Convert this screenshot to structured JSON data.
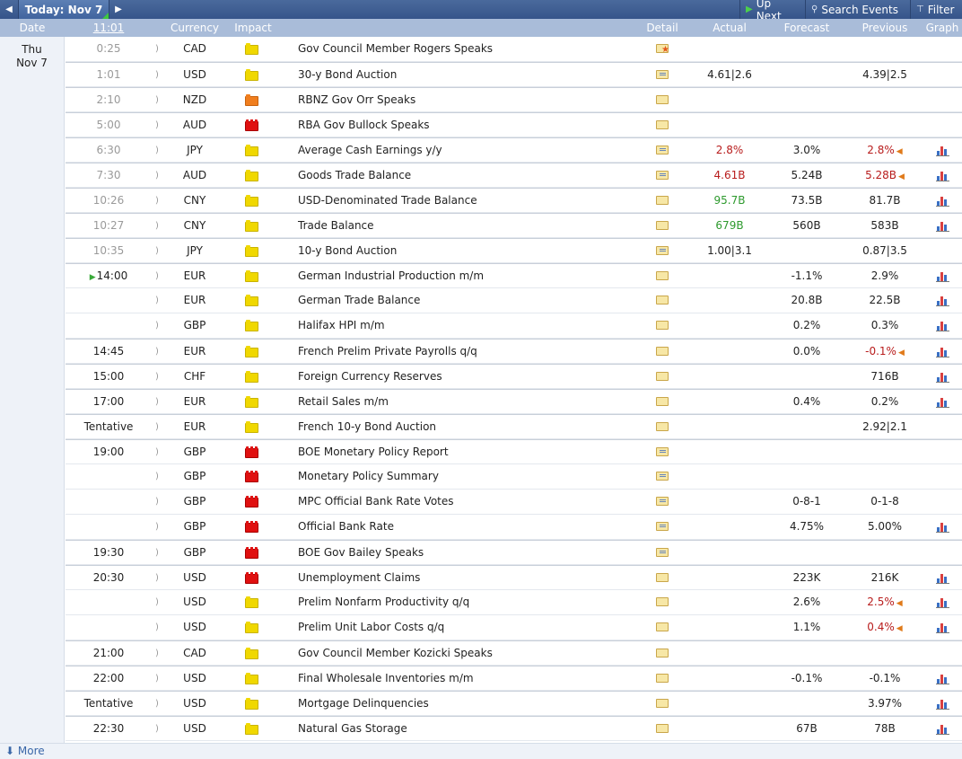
{
  "toolbar": {
    "prev_label": "◀",
    "today_label": "Today: Nov 7",
    "next_label": "▶",
    "up_next_label": "Up Next",
    "search_label": "Search Events",
    "filter_label": "Filter"
  },
  "columns": {
    "date": "Date",
    "clock": "11:01",
    "currency": "Currency",
    "impact": "Impact",
    "detail": "Detail",
    "actual": "Actual",
    "forecast": "Forecast",
    "previous": "Previous",
    "graph": "Graph"
  },
  "date": {
    "weekday": "Thu",
    "day": "Nov 7"
  },
  "events": [
    {
      "time": "0:25",
      "past": true,
      "currency": "CAD",
      "impact": "low",
      "event": "Gov Council Member Rogers Speaks",
      "detail": "star",
      "actual": "",
      "actual_color": "black",
      "forecast": "",
      "previous": "",
      "previous_color": "black",
      "revised": false,
      "graph": false,
      "group_start": true
    },
    {
      "time": "1:01",
      "past": true,
      "currency": "USD",
      "impact": "low",
      "event": "30-y Bond Auction",
      "detail": "doc",
      "actual": "4.61|2.6",
      "actual_color": "black",
      "forecast": "",
      "previous": "4.39|2.5",
      "previous_color": "black",
      "revised": false,
      "graph": false,
      "group_start": true
    },
    {
      "time": "2:10",
      "past": true,
      "currency": "NZD",
      "impact": "med",
      "event": "RBNZ Gov Orr Speaks",
      "detail": "folder",
      "actual": "",
      "actual_color": "black",
      "forecast": "",
      "previous": "",
      "previous_color": "black",
      "revised": false,
      "graph": false,
      "group_start": true
    },
    {
      "time": "5:00",
      "past": true,
      "currency": "AUD",
      "impact": "high",
      "event": "RBA Gov Bullock Speaks",
      "detail": "folder",
      "actual": "",
      "actual_color": "black",
      "forecast": "",
      "previous": "",
      "previous_color": "black",
      "revised": false,
      "graph": false,
      "group_start": true
    },
    {
      "time": "6:30",
      "past": true,
      "currency": "JPY",
      "impact": "low",
      "event": "Average Cash Earnings y/y",
      "detail": "doc",
      "actual": "2.8%",
      "actual_color": "red",
      "forecast": "3.0%",
      "previous": "2.8%",
      "previous_color": "red",
      "revised": true,
      "graph": true,
      "group_start": true
    },
    {
      "time": "7:30",
      "past": true,
      "currency": "AUD",
      "impact": "low",
      "event": "Goods Trade Balance",
      "detail": "doc",
      "actual": "4.61B",
      "actual_color": "red",
      "forecast": "5.24B",
      "previous": "5.28B",
      "previous_color": "red",
      "revised": true,
      "graph": true,
      "group_start": true
    },
    {
      "time": "10:26",
      "past": true,
      "currency": "CNY",
      "impact": "low",
      "event": "USD-Denominated Trade Balance",
      "detail": "folder",
      "actual": "95.7B",
      "actual_color": "green",
      "forecast": "73.5B",
      "previous": "81.7B",
      "previous_color": "black",
      "revised": false,
      "graph": true,
      "group_start": true
    },
    {
      "time": "10:27",
      "past": true,
      "currency": "CNY",
      "impact": "low",
      "event": "Trade Balance",
      "detail": "folder",
      "actual": "679B",
      "actual_color": "green",
      "forecast": "560B",
      "previous": "583B",
      "previous_color": "black",
      "revised": false,
      "graph": true,
      "group_start": true
    },
    {
      "time": "10:35",
      "past": true,
      "currency": "JPY",
      "impact": "low",
      "event": "10-y Bond Auction",
      "detail": "doc",
      "actual": "1.00|3.1",
      "actual_color": "black",
      "forecast": "",
      "previous": "0.87|3.5",
      "previous_color": "black",
      "revised": false,
      "graph": false,
      "group_start": true
    },
    {
      "time": "14:00",
      "past": false,
      "next": true,
      "currency": "EUR",
      "impact": "low",
      "event": "German Industrial Production m/m",
      "detail": "folder",
      "actual": "",
      "actual_color": "black",
      "forecast": "-1.1%",
      "previous": "2.9%",
      "previous_color": "black",
      "revised": false,
      "graph": true,
      "group_start": true
    },
    {
      "time": "",
      "past": false,
      "currency": "EUR",
      "impact": "low",
      "event": "German Trade Balance",
      "detail": "folder",
      "actual": "",
      "actual_color": "black",
      "forecast": "20.8B",
      "previous": "22.5B",
      "previous_color": "black",
      "revised": false,
      "graph": true,
      "group_start": false
    },
    {
      "time": "",
      "past": false,
      "currency": "GBP",
      "impact": "low",
      "event": "Halifax HPI m/m",
      "detail": "folder",
      "actual": "",
      "actual_color": "black",
      "forecast": "0.2%",
      "previous": "0.3%",
      "previous_color": "black",
      "revised": false,
      "graph": true,
      "group_start": false
    },
    {
      "time": "14:45",
      "past": false,
      "currency": "EUR",
      "impact": "low",
      "event": "French Prelim Private Payrolls q/q",
      "detail": "folder",
      "actual": "",
      "actual_color": "black",
      "forecast": "0.0%",
      "previous": "-0.1%",
      "previous_color": "red",
      "revised": true,
      "graph": true,
      "group_start": true
    },
    {
      "time": "15:00",
      "past": false,
      "currency": "CHF",
      "impact": "low",
      "event": "Foreign Currency Reserves",
      "detail": "folder",
      "actual": "",
      "actual_color": "black",
      "forecast": "",
      "previous": "716B",
      "previous_color": "black",
      "revised": false,
      "graph": true,
      "group_start": true
    },
    {
      "time": "17:00",
      "past": false,
      "currency": "EUR",
      "impact": "low",
      "event": "Retail Sales m/m",
      "detail": "folder",
      "actual": "",
      "actual_color": "black",
      "forecast": "0.4%",
      "previous": "0.2%",
      "previous_color": "black",
      "revised": false,
      "graph": true,
      "group_start": true
    },
    {
      "time": "Tentative",
      "past": false,
      "currency": "EUR",
      "impact": "low",
      "event": "French 10-y Bond Auction",
      "detail": "folder",
      "actual": "",
      "actual_color": "black",
      "forecast": "",
      "previous": "2.92|2.1",
      "previous_color": "black",
      "revised": false,
      "graph": false,
      "group_start": true
    },
    {
      "time": "19:00",
      "past": false,
      "currency": "GBP",
      "impact": "high",
      "event": "BOE Monetary Policy Report",
      "detail": "doc",
      "actual": "",
      "actual_color": "black",
      "forecast": "",
      "previous": "",
      "previous_color": "black",
      "revised": false,
      "graph": false,
      "group_start": true
    },
    {
      "time": "",
      "past": false,
      "currency": "GBP",
      "impact": "high",
      "event": "Monetary Policy Summary",
      "detail": "doc",
      "actual": "",
      "actual_color": "black",
      "forecast": "",
      "previous": "",
      "previous_color": "black",
      "revised": false,
      "graph": false,
      "group_start": false
    },
    {
      "time": "",
      "past": false,
      "currency": "GBP",
      "impact": "high",
      "event": "MPC Official Bank Rate Votes",
      "detail": "doc",
      "actual": "",
      "actual_color": "black",
      "forecast": "0-8-1",
      "previous": "0-1-8",
      "previous_color": "black",
      "revised": false,
      "graph": false,
      "group_start": false
    },
    {
      "time": "",
      "past": false,
      "currency": "GBP",
      "impact": "high",
      "event": "Official Bank Rate",
      "detail": "doc",
      "actual": "",
      "actual_color": "black",
      "forecast": "4.75%",
      "previous": "5.00%",
      "previous_color": "black",
      "revised": false,
      "graph": true,
      "group_start": false
    },
    {
      "time": "19:30",
      "past": false,
      "currency": "GBP",
      "impact": "high",
      "event": "BOE Gov Bailey Speaks",
      "detail": "doc",
      "actual": "",
      "actual_color": "black",
      "forecast": "",
      "previous": "",
      "previous_color": "black",
      "revised": false,
      "graph": false,
      "group_start": true
    },
    {
      "time": "20:30",
      "past": false,
      "currency": "USD",
      "impact": "high",
      "event": "Unemployment Claims",
      "detail": "folder",
      "actual": "",
      "actual_color": "black",
      "forecast": "223K",
      "previous": "216K",
      "previous_color": "black",
      "revised": false,
      "graph": true,
      "group_start": true
    },
    {
      "time": "",
      "past": false,
      "currency": "USD",
      "impact": "low",
      "event": "Prelim Nonfarm Productivity q/q",
      "detail": "folder",
      "actual": "",
      "actual_color": "black",
      "forecast": "2.6%",
      "previous": "2.5%",
      "previous_color": "red",
      "revised": true,
      "graph": true,
      "group_start": false
    },
    {
      "time": "",
      "past": false,
      "currency": "USD",
      "impact": "low",
      "event": "Prelim Unit Labor Costs q/q",
      "detail": "folder",
      "actual": "",
      "actual_color": "black",
      "forecast": "1.1%",
      "previous": "0.4%",
      "previous_color": "red",
      "revised": true,
      "graph": true,
      "group_start": false
    },
    {
      "time": "21:00",
      "past": false,
      "currency": "CAD",
      "impact": "low",
      "event": "Gov Council Member Kozicki Speaks",
      "detail": "folder",
      "actual": "",
      "actual_color": "black",
      "forecast": "",
      "previous": "",
      "previous_color": "black",
      "revised": false,
      "graph": false,
      "group_start": true
    },
    {
      "time": "22:00",
      "past": false,
      "currency": "USD",
      "impact": "low",
      "event": "Final Wholesale Inventories m/m",
      "detail": "folder",
      "actual": "",
      "actual_color": "black",
      "forecast": "-0.1%",
      "previous": "-0.1%",
      "previous_color": "black",
      "revised": false,
      "graph": true,
      "group_start": true
    },
    {
      "time": "Tentative",
      "past": false,
      "currency": "USD",
      "impact": "low",
      "event": "Mortgage Delinquencies",
      "detail": "folder",
      "actual": "",
      "actual_color": "black",
      "forecast": "",
      "previous": "3.97%",
      "previous_color": "black",
      "revised": false,
      "graph": true,
      "group_start": true
    },
    {
      "time": "22:30",
      "past": false,
      "currency": "USD",
      "impact": "low",
      "event": "Natural Gas Storage",
      "detail": "folder",
      "actual": "",
      "actual_color": "black",
      "forecast": "67B",
      "previous": "78B",
      "previous_color": "black",
      "revised": false,
      "graph": true,
      "group_start": true
    }
  ],
  "footer": {
    "more_label": "More"
  }
}
